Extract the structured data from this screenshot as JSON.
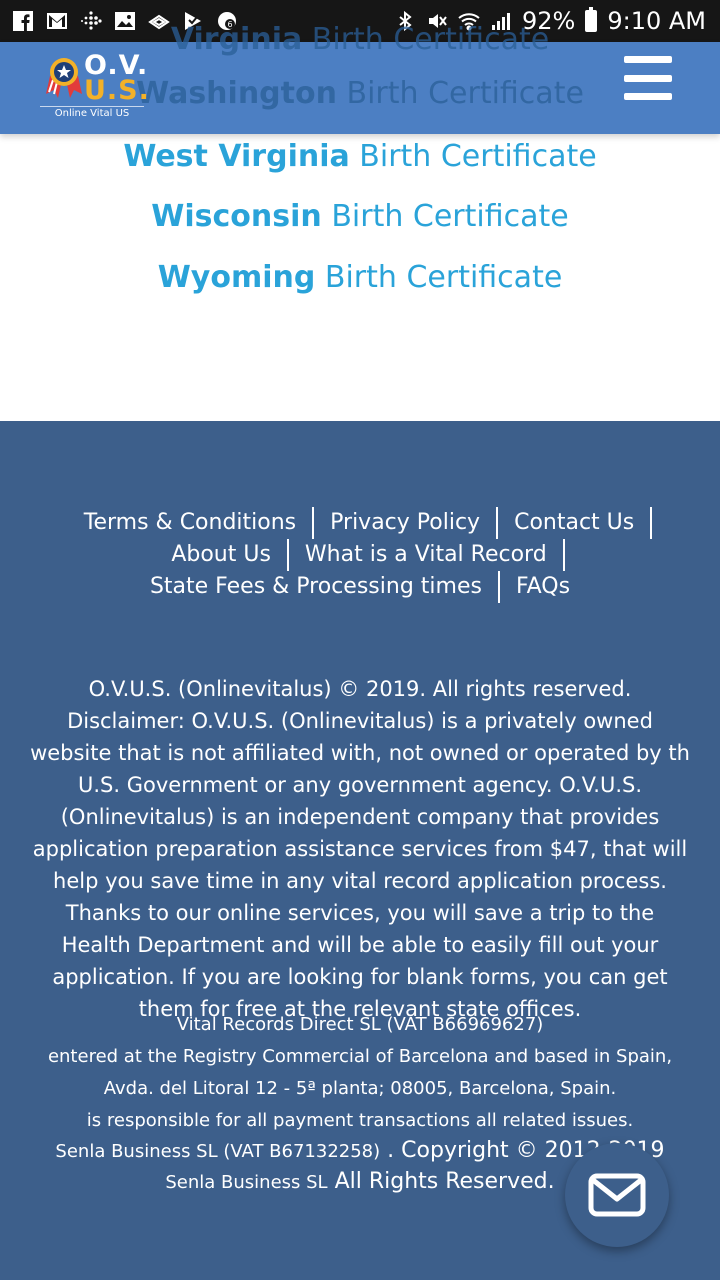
{
  "status_bar": {
    "battery": "92%",
    "time": "9:10 AM"
  },
  "header": {
    "logo_top": "O.V.",
    "logo_bottom": "U.S.",
    "logo_tagline": "Online Vital US",
    "under_header_state_1": "Virginia",
    "under_header_suffix_1": "Birth Certificate",
    "under_header_state_2": "Washington",
    "under_header_suffix_2": "Birth Certificate"
  },
  "states": [
    {
      "name": "West Virginia",
      "suffix": "Birth Certificate"
    },
    {
      "name": "Wisconsin",
      "suffix": "Birth Certificate"
    },
    {
      "name": "Wyoming",
      "suffix": "Birth Certificate"
    }
  ],
  "footer_links": {
    "terms": "Terms & Conditions",
    "privacy": "Privacy Policy",
    "contact": "Contact Us",
    "about": "About Us",
    "vital_record": "What is a Vital Record",
    "state_fees": "State Fees & Processing times",
    "faqs": "FAQs"
  },
  "disclaimer": "O.V.U.S. (Onlinevitalus) © 2019. All rights reserved. Disclaimer: O.V.U.S. (Onlinevitalus) is a privately owned website that is not affiliated with, not owned or operated by th U.S. Government or any government agency. O.V.U.S. (Onlinevitalus) is an independent company that provides application preparation assistance services from $47, that will help you save time in any vital record application process. Thanks to our online services, you will save a trip to the Health Department and will be able to easily fill out your application. If you are looking for blank forms, you can get them for free at the relevant state offices.",
  "company": {
    "line1": "Vital Records Direct SL  (VAT B66969627)",
    "line2": "entered at the Registry   Commercial of Barcelona    and based in Spain,",
    "line3": "Avda. del Litoral 12 - 5ª  planta; 08005,   Barcelona, Spain.",
    "line4": "is responsible for all  payment transactions   all related issues.",
    "line5a": "Senla Business SL (VAT B67132258)",
    "line5b": " . Copyright © 2012-2019",
    "line6a": "Senla Business SL",
    "line6b": " All Rights Reserved."
  },
  "colors": {
    "header_bg": "#4c7fc3",
    "footer_bg": "#3d5f8b",
    "link_blue": "#2aa3d9"
  }
}
